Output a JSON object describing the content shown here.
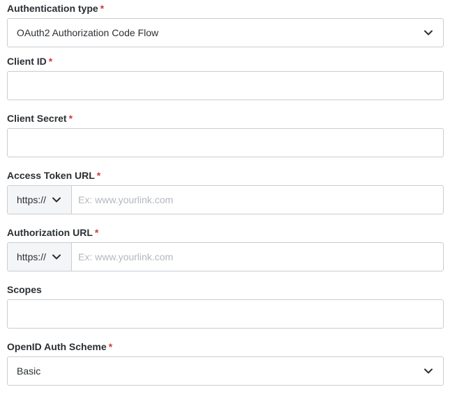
{
  "form": {
    "auth_type": {
      "label": "Authentication type",
      "required_mark": "*",
      "value": "OAuth2 Authorization Code Flow",
      "icon": "chevron-down-icon"
    },
    "client_id": {
      "label": "Client ID",
      "required_mark": "*",
      "value": "",
      "placeholder": ""
    },
    "client_secret": {
      "label": "Client Secret",
      "required_mark": "*",
      "value": "",
      "placeholder": ""
    },
    "access_token_url": {
      "label": "Access Token URL",
      "required_mark": "*",
      "protocol": "https://",
      "placeholder": "Ex: www.yourlink.com",
      "value": ""
    },
    "authorization_url": {
      "label": "Authorization URL",
      "required_mark": "*",
      "protocol": "https://",
      "placeholder": "Ex: www.yourlink.com",
      "value": ""
    },
    "scopes": {
      "label": "Scopes",
      "value": "",
      "placeholder": ""
    },
    "openid_auth_scheme": {
      "label": "OpenID Auth Scheme",
      "required_mark": "*",
      "value": "Basic",
      "icon": "chevron-down-icon"
    }
  },
  "colors": {
    "required": "#d23a3a",
    "border": "#c9cdd2",
    "prefix_bg": "#f4f5f7",
    "placeholder": "#b3b8be",
    "text": "#2b2f33"
  }
}
